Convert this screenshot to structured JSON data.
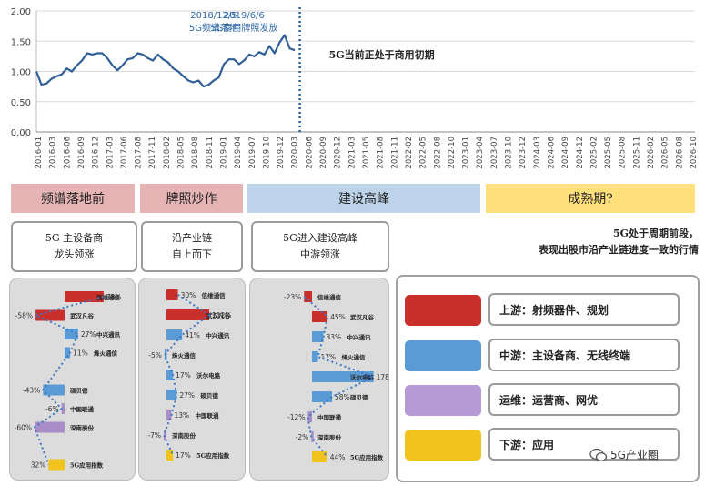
{
  "chart_data": {
    "type": "line",
    "y_ticks": [
      "2.00",
      "1.50",
      "1.00",
      "0.50",
      "0.00"
    ],
    "ylim": [
      0,
      2
    ],
    "x_ticks": [
      "2016-01",
      "2016-03",
      "2016-05",
      "2016-07",
      "2016-09",
      "2016-11",
      "2017-01",
      "2017-03",
      "2017-05",
      "2017-07",
      "2017-09",
      "2017-11",
      "2018-01",
      "2018-03",
      "2018-05",
      "2018-07",
      "2018-09",
      "2018-11",
      "2019-01",
      "2019-03",
      "2019-05",
      "2019-07",
      "2019-09",
      "2019-11",
      "2020-01",
      "2020-03",
      "2020-05",
      "2020-07",
      "2020-09",
      "2020-11",
      "2021-01",
      "2021-03",
      "2021-05",
      "2021-07",
      "2021-09",
      "2021-11",
      "2022-01",
      "2022-03",
      "2022-05",
      "2022-07",
      "2022-09",
      "2022-11",
      "2023-01",
      "2023-03",
      "2023-05",
      "2023-07",
      "2023-09",
      "2023-11",
      "2024-01",
      "2024-03",
      "2024-05",
      "2024-07",
      "2024-09",
      "2024-11",
      "2025-01",
      "2025-03",
      "2025-05",
      "2025-07",
      "2025-09",
      "2025-11",
      "2026-01",
      "2026-03",
      "2026-05",
      "2026-07",
      "2026-09",
      "2026-11"
    ],
    "x_tick_labels": [
      "2016-01",
      "2016-03",
      "2016-06",
      "2016-09",
      "2016-12",
      "2017-03",
      "2017-06",
      "2017-08",
      "2017-11",
      "2018-02",
      "2018-05",
      "2018-08",
      "2018-11",
      "2019-01",
      "2019-04",
      "2019-07",
      "2019-10",
      "2019-12",
      "2020-03",
      "2020-06",
      "2020-09",
      "2020-12",
      "2021-03",
      "2021-05",
      "2021-08",
      "2021-11",
      "2022-02",
      "2022-05",
      "2022-08",
      "2022-10",
      "2023-01",
      "2023-04",
      "2023-07",
      "2023-10",
      "2023-12",
      "2024-03",
      "2024-06",
      "2024-09",
      "2024-12",
      "2025-02",
      "2025-05",
      "2025-08",
      "2025-11",
      "2026-02",
      "2026-05",
      "2026-08",
      "2026-10"
    ],
    "series": [
      {
        "color": "#2f5f96",
        "points": [
          [
            "2016-01",
            1.0
          ],
          [
            "2016-02",
            0.78
          ],
          [
            "2016-03",
            0.8
          ],
          [
            "2016-04",
            0.88
          ],
          [
            "2016-05",
            0.92
          ],
          [
            "2016-06",
            0.95
          ],
          [
            "2016-07",
            1.05
          ],
          [
            "2016-08",
            1.0
          ],
          [
            "2016-09",
            1.1
          ],
          [
            "2016-10",
            1.18
          ],
          [
            "2016-11",
            1.3
          ],
          [
            "2016-12",
            1.28
          ],
          [
            "2017-01",
            1.3
          ],
          [
            "2017-02",
            1.3
          ],
          [
            "2017-03",
            1.22
          ],
          [
            "2017-04",
            1.1
          ],
          [
            "2017-05",
            1.02
          ],
          [
            "2017-06",
            1.1
          ],
          [
            "2017-07",
            1.2
          ],
          [
            "2017-08",
            1.22
          ],
          [
            "2017-09",
            1.3
          ],
          [
            "2017-10",
            1.28
          ],
          [
            "2017-11",
            1.22
          ],
          [
            "2017-12",
            1.18
          ],
          [
            "2018-01",
            1.28
          ],
          [
            "2018-02",
            1.2
          ],
          [
            "2018-03",
            1.15
          ],
          [
            "2018-04",
            1.05
          ],
          [
            "2018-05",
            1.0
          ],
          [
            "2018-06",
            0.92
          ],
          [
            "2018-07",
            0.85
          ],
          [
            "2018-08",
            0.82
          ],
          [
            "2018-09",
            0.85
          ],
          [
            "2018-10",
            0.75
          ],
          [
            "2018-11",
            0.78
          ],
          [
            "2018-12",
            0.85
          ],
          [
            "2019-01",
            0.9
          ],
          [
            "2019-02",
            1.12
          ],
          [
            "2019-03",
            1.2
          ],
          [
            "2019-04",
            1.2
          ],
          [
            "2019-05",
            1.12
          ],
          [
            "2019-06",
            1.18
          ],
          [
            "2019-07",
            1.28
          ],
          [
            "2019-08",
            1.25
          ],
          [
            "2019-09",
            1.32
          ],
          [
            "2019-10",
            1.28
          ],
          [
            "2019-11",
            1.42
          ],
          [
            "2019-12",
            1.3
          ],
          [
            "2020-01",
            1.48
          ],
          [
            "2020-02",
            1.6
          ],
          [
            "2020-03",
            1.38
          ],
          [
            "2020-04",
            1.35
          ]
        ]
      }
    ],
    "annotations": [
      {
        "x": "2018-12",
        "lines": [
          "2018/12/5",
          "5G频谱落地"
        ]
      },
      {
        "x": "2019-06",
        "lines": [
          "2019/6/6",
          "5G商用牌照发放"
        ]
      }
    ],
    "current_marker": {
      "x": "2020-05",
      "label": "5G当前正处于商用初期"
    },
    "grid": true
  },
  "phases": [
    {
      "label": "频谱落地前",
      "color": "#e6b4b4"
    },
    {
      "label": "牌照炒作",
      "color": "#e6b4b4"
    },
    {
      "label": "建设高峰",
      "color": "#bdd3ea"
    },
    {
      "label": "成熟期?",
      "color": "#ffe07a"
    }
  ],
  "phase_notes": [
    {
      "lines": [
        "5G 主设备商",
        "龙头领涨"
      ]
    },
    {
      "lines": [
        "沿产业链",
        "自上而下"
      ]
    },
    {
      "lines": [
        "5G进入建设高峰",
        "中游领涨"
      ]
    }
  ],
  "summary": {
    "line1": "5G处于周期前段，",
    "line2": "表现出股市沿产业链进度一致的行情"
  },
  "panels": [
    {
      "bars": [
        {
          "name": "信维通信",
          "value": 78,
          "label": "78%",
          "tier": "upstream"
        },
        {
          "name": "武汉凡谷",
          "value": -58,
          "label": "-58%",
          "tier": "upstream"
        },
        {
          "name": "中兴通讯",
          "value": 27,
          "label": "27%",
          "tier": "midstream"
        },
        {
          "name": "烽火通信",
          "value": 11,
          "label": "11%",
          "tier": "midstream"
        },
        {
          "name": "硕贝德",
          "value": -43,
          "label": "-43%",
          "tier": "midstream"
        },
        {
          "name": "中国联通",
          "value": -6,
          "label": "-6%",
          "tier": "operator"
        },
        {
          "name": "深南股份",
          "value": -60,
          "label": "-60%",
          "tier": "operator"
        },
        {
          "name": "5G应用指数",
          "value": -32,
          "label": "32%",
          "tier": "downstream"
        }
      ]
    },
    {
      "bars": [
        {
          "name": "信维通信",
          "value": 30,
          "label": "30%",
          "tier": "upstream"
        },
        {
          "name": "武汉凡谷",
          "value": 112,
          "label": "112%",
          "tier": "upstream"
        },
        {
          "name": "中兴通讯",
          "value": 41,
          "label": "41%",
          "tier": "midstream"
        },
        {
          "name": "烽火通信",
          "value": -5,
          "label": "-5%",
          "tier": "midstream"
        },
        {
          "name": "沃尔电路",
          "value": 17,
          "label": "17%",
          "tier": "midstream"
        },
        {
          "name": "硕贝德",
          "value": 27,
          "label": "27%",
          "tier": "midstream"
        },
        {
          "name": "中国联通",
          "value": 13,
          "label": "13%",
          "tier": "operator"
        },
        {
          "name": "深南股份",
          "value": -7,
          "label": "-7%",
          "tier": "operator"
        },
        {
          "name": "5G应用指数",
          "value": 17,
          "label": "17%",
          "tier": "downstream"
        }
      ]
    },
    {
      "bars": [
        {
          "name": "信维通信",
          "value": -23,
          "label": "-23%",
          "tier": "upstream"
        },
        {
          "name": "武汉凡谷",
          "value": 45,
          "label": "45%",
          "tier": "upstream"
        },
        {
          "name": "中兴通讯",
          "value": 33,
          "label": "33%",
          "tier": "midstream"
        },
        {
          "name": "烽火通信",
          "value": 17,
          "label": "17%",
          "tier": "midstream"
        },
        {
          "name": "沃尔电路",
          "value": 178,
          "label": "178%",
          "tier": "midstream"
        },
        {
          "name": "硕贝德",
          "value": 58,
          "label": "58%",
          "tier": "midstream"
        },
        {
          "name": "中国联通",
          "value": -12,
          "label": "-12%",
          "tier": "operator"
        },
        {
          "name": "深南股份",
          "value": -2,
          "label": "-2%",
          "tier": "operator"
        },
        {
          "name": "5G应用指数",
          "value": 44,
          "label": "44%",
          "tier": "downstream"
        }
      ]
    }
  ],
  "tier_colors": {
    "upstream": "#c9302c",
    "midstream": "#5b9bd5",
    "operator": "#a98dc6",
    "downstream": "#f2c31d"
  },
  "legend": [
    {
      "label": "上游：射频器件、规划",
      "color": "#c9302c"
    },
    {
      "label": "中游：主设备商、无线终端",
      "color": "#5b9bd5"
    },
    {
      "label": "运维：运营商、网优",
      "color": "#b59ad4"
    },
    {
      "label": "下游：应用",
      "color": "#f2c31d"
    }
  ],
  "watermark": {
    "text": "5G产业圈"
  }
}
